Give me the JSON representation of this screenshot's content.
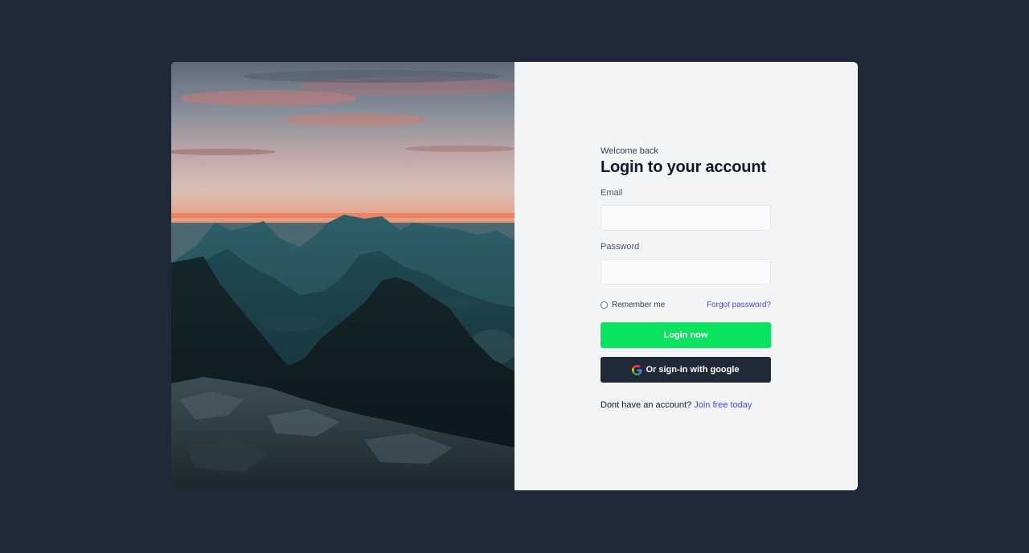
{
  "photo": {
    "description_icon": "mountain-sunset-image"
  },
  "form": {
    "welcome": "Welcome back",
    "title": "Login to your account",
    "email_label": "Email",
    "email_value": "",
    "password_label": "Password",
    "password_value": "",
    "remember_label": "Remember me",
    "forgot_label": "Forgot password?",
    "login_button": "Login now",
    "google_button": "Or sign-in with google",
    "signup_prompt": "Dont have an account?",
    "signup_link": "Join free today"
  },
  "colors": {
    "page_bg": "#1f2937",
    "accent_green": "#09e35f",
    "link_purple": "#4f46e5",
    "dark_button": "#1f2937"
  }
}
